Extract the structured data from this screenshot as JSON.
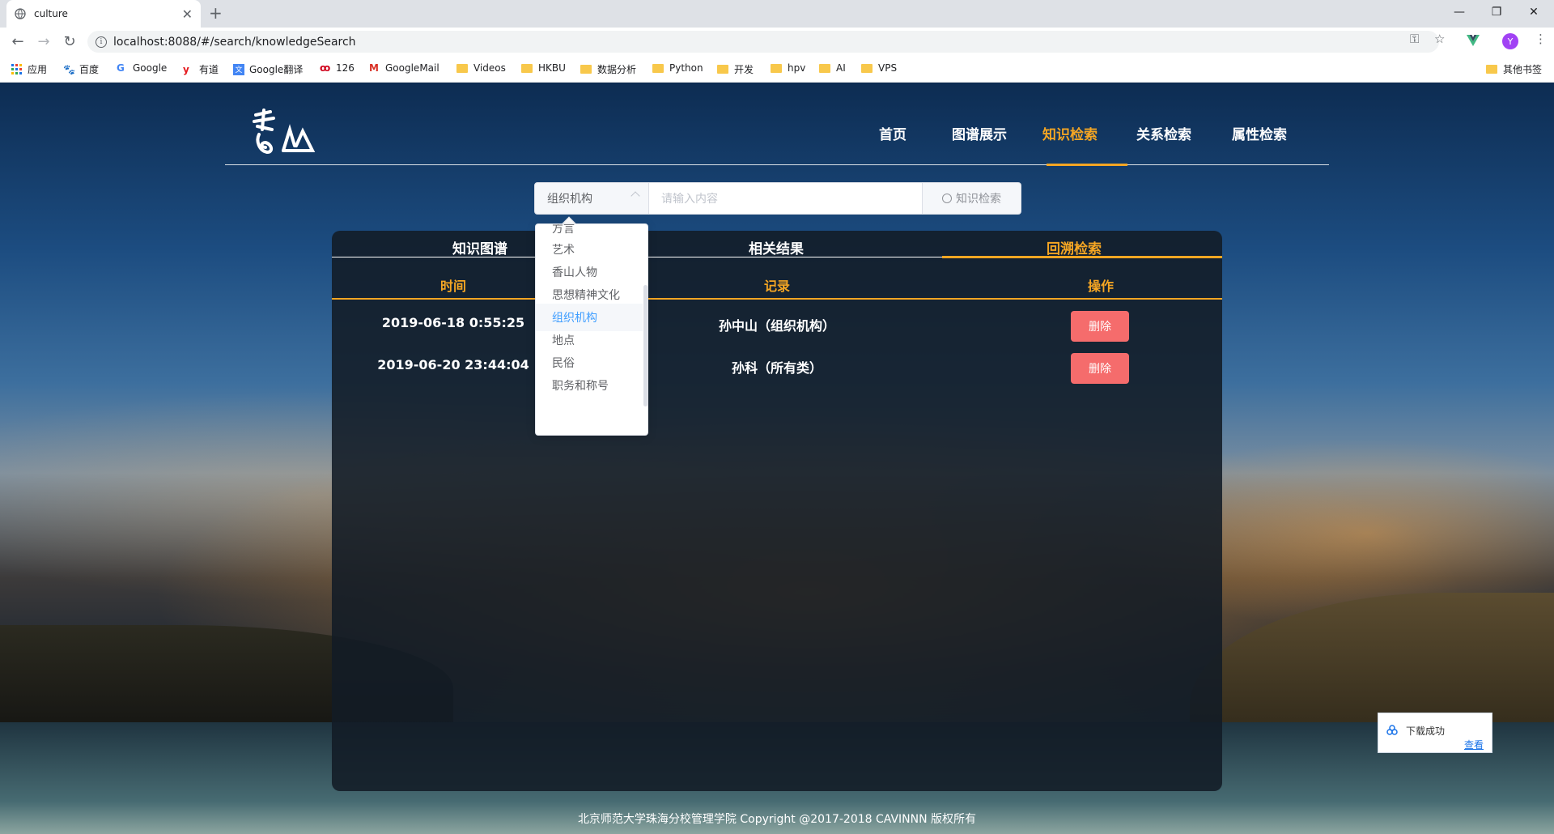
{
  "browser": {
    "tab_title": "culture",
    "url": "localhost:8088/#/search/knowledgeSearch",
    "avatar_letter": "Y",
    "bookmarks": [
      "应用",
      "百度",
      "Google",
      "有道",
      "Google翻译",
      "126",
      "GoogleMail",
      "Videos",
      "HKBU",
      "数据分析",
      "Python",
      "开发",
      "hpv",
      "AI",
      "VPS"
    ],
    "other_bookmarks": "其他书签"
  },
  "nav": {
    "items": [
      "首页",
      "图谱展示",
      "知识检索",
      "关系检索",
      "属性检索"
    ],
    "active": "知识检索"
  },
  "search": {
    "category": "组织机构",
    "placeholder": "请输入内容",
    "button": "知识检索"
  },
  "dropdown": {
    "options": [
      "方言",
      "艺术",
      "香山人物",
      "思想精神文化",
      "组织机构",
      "地点",
      "民俗",
      "职务和称号"
    ],
    "selected": "组织机构"
  },
  "panel": {
    "tabs": [
      "知识图谱",
      "相关结果",
      "回溯检索"
    ],
    "active_tab": "回溯检索",
    "columns": [
      "时间",
      "记录",
      "操作"
    ],
    "rows": [
      {
        "time": "2019-06-18 0:55:25",
        "record": "孙中山（组织机构）",
        "action": "删除"
      },
      {
        "time": "2019-06-20 23:44:04",
        "record": "孙科（所有类）",
        "action": "删除"
      }
    ]
  },
  "footer": "北京师范大学珠海分校管理学院 Copyright @2017-2018 CAVINNN 版权所有",
  "toast": {
    "message": "下载成功",
    "link": "查看"
  },
  "colors": {
    "accent": "#f5a623",
    "danger": "#f56c6c",
    "selected": "#409eff"
  }
}
